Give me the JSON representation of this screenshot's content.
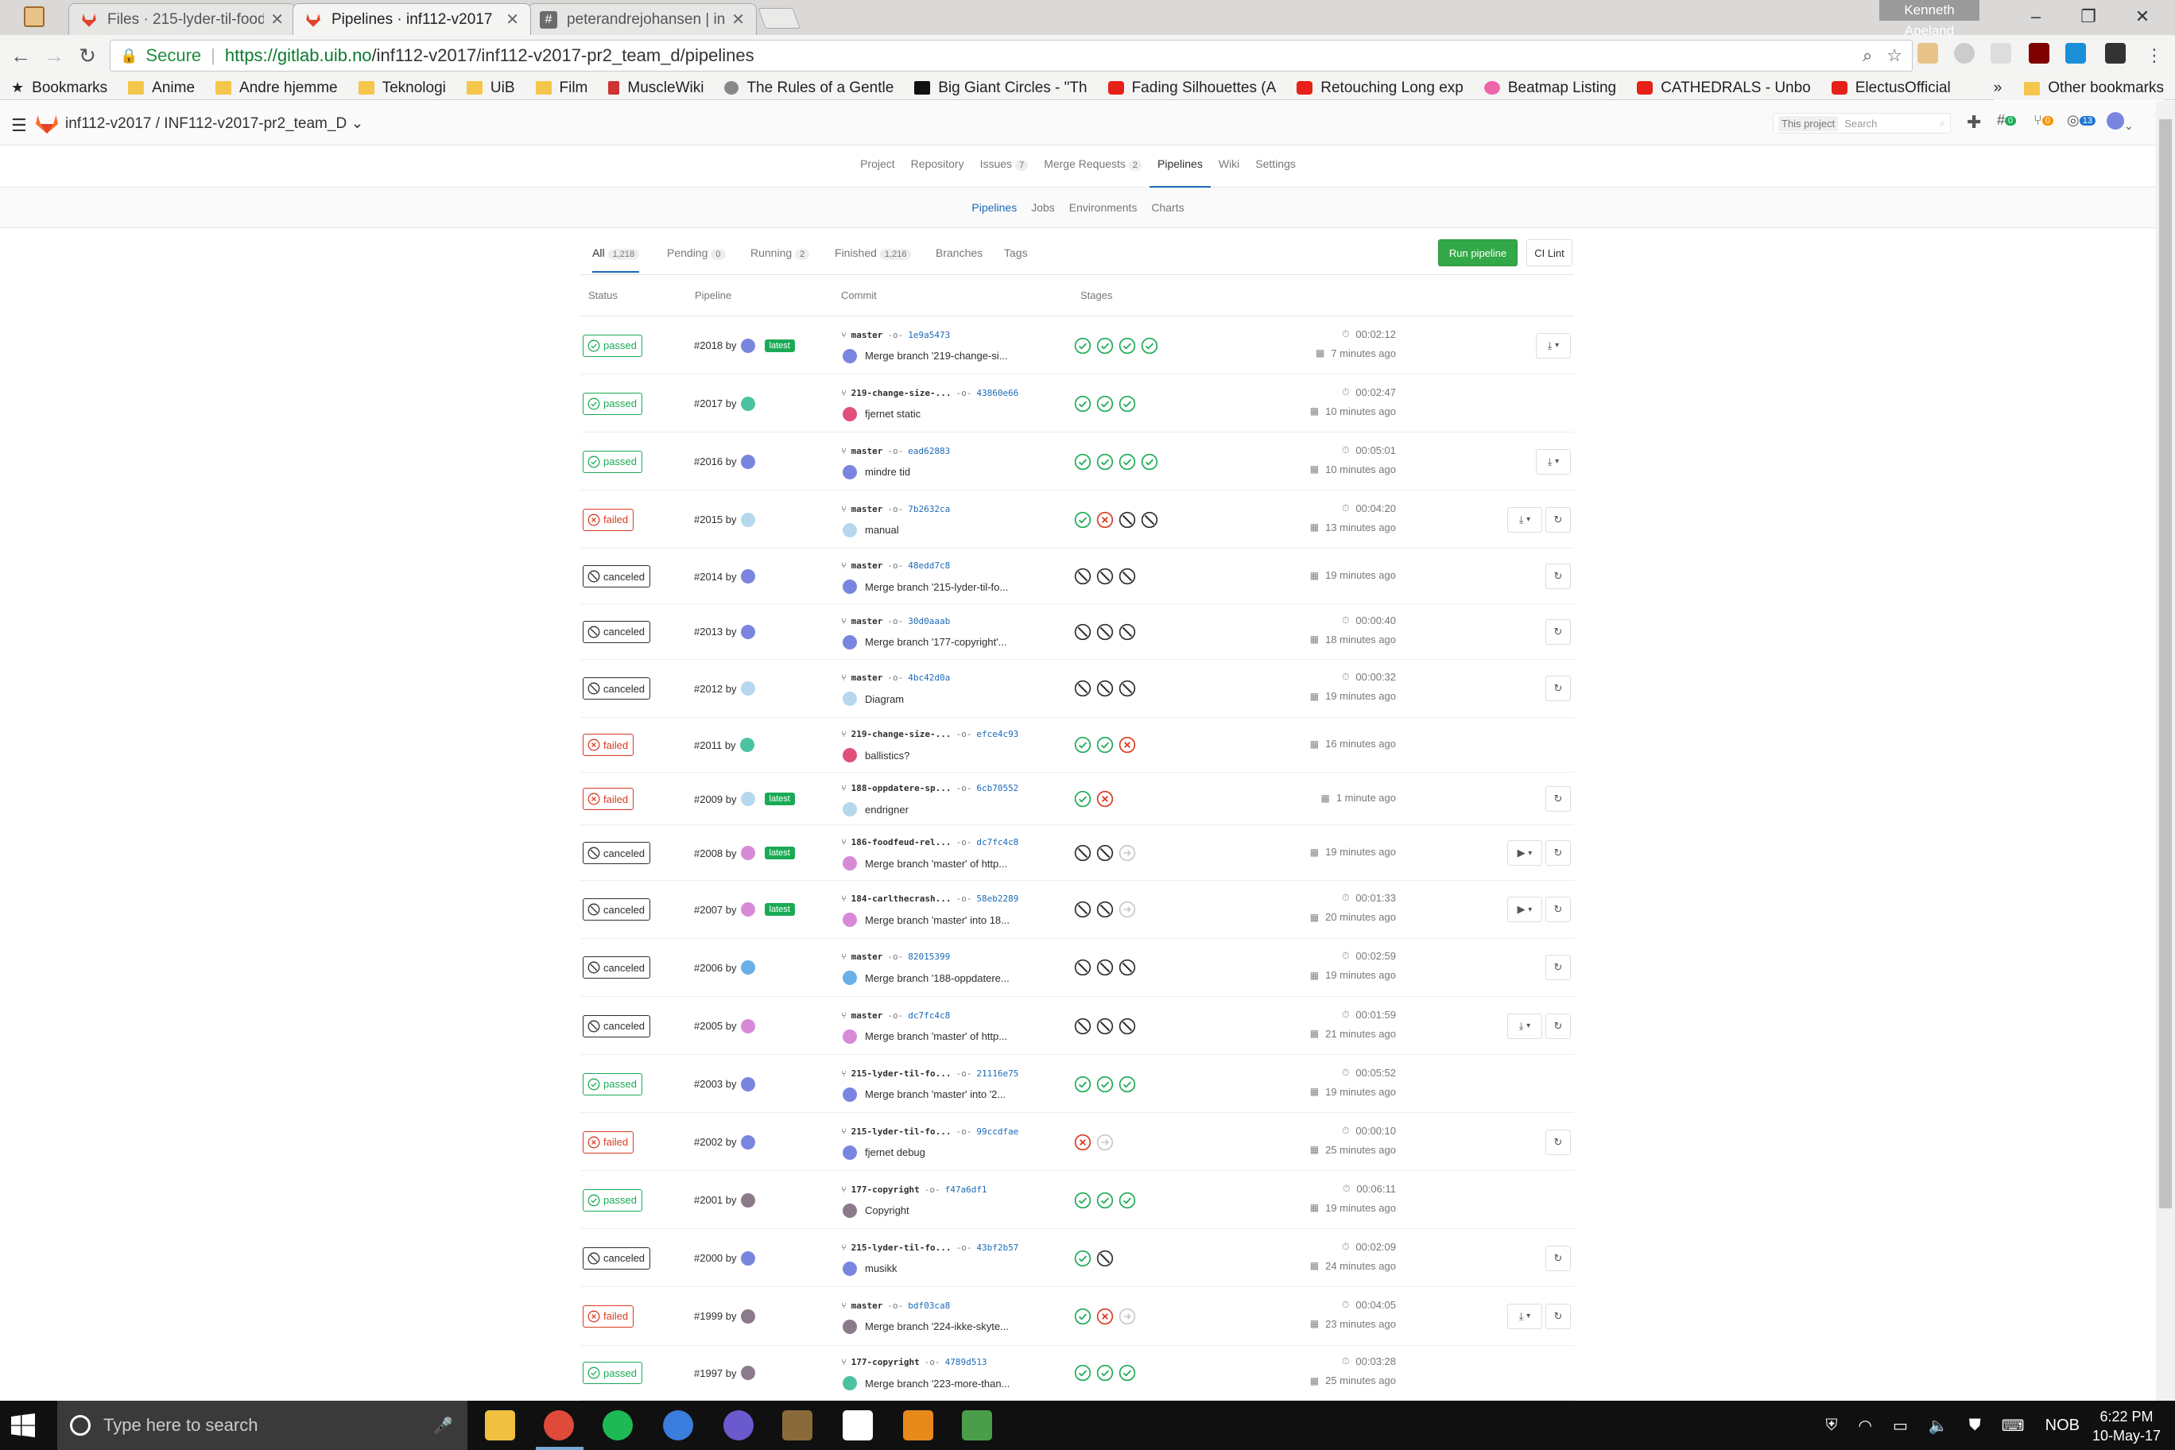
{
  "browser": {
    "tabs": [
      {
        "title": "Files · 215-lyder-til-foodf"
      },
      {
        "title": "Pipelines · inf112-v2017"
      },
      {
        "title": "peterandrejohansen | inf"
      }
    ],
    "profile_name": "Kenneth Apeland",
    "secure_label": "Secure",
    "url": "https://gitlab.uib.no/inf112-v2017/inf112-v2017-pr2_team_d/pipelines",
    "url_scheme_host": "https://gitlab.uib.no",
    "url_path": "/inf112-v2017/inf112-v2017-pr2_team_d/pipelines"
  },
  "bookmarks": {
    "items": [
      {
        "label": "Bookmarks",
        "icon": "star-icon"
      },
      {
        "label": "Anime",
        "icon": "folder-icon"
      },
      {
        "label": "Andre hjemme",
        "icon": "folder-icon"
      },
      {
        "label": "Teknologi",
        "icon": "folder-icon"
      },
      {
        "label": "UiB",
        "icon": "folder-icon"
      },
      {
        "label": "Film",
        "icon": "folder-icon"
      },
      {
        "label": "MuscleWiki",
        "icon": "site-icon"
      },
      {
        "label": "The Rules of a Gentle",
        "icon": "site-icon"
      },
      {
        "label": "Big Giant Circles - \"Th",
        "icon": "site-icon"
      },
      {
        "label": "Fading Silhouettes (A",
        "icon": "youtube-icon"
      },
      {
        "label": "Retouching Long exp",
        "icon": "youtube-icon"
      },
      {
        "label": "Beatmap Listing",
        "icon": "osu-icon"
      },
      {
        "label": "CATHEDRALS - Unbo",
        "icon": "youtube-icon"
      },
      {
        "label": "ElectusOfficial",
        "icon": "youtube-icon"
      }
    ],
    "overflow": "»",
    "other": "Other bookmarks"
  },
  "gitlab": {
    "breadcrumb": "inf112-v2017 / INF112-v2017-pr2_team_D",
    "search_scope": "This project",
    "search_placeholder": "Search",
    "header_counts": {
      "todos": "0",
      "merge_requests": "0",
      "issues": "13"
    },
    "project_tabs": [
      {
        "label": "Project"
      },
      {
        "label": "Repository"
      },
      {
        "label": "Issues",
        "count": "7"
      },
      {
        "label": "Merge Requests",
        "count": "2"
      },
      {
        "label": "Pipelines"
      },
      {
        "label": "Wiki"
      },
      {
        "label": "Settings"
      }
    ],
    "sub_tabs": [
      "Pipelines",
      "Jobs",
      "Environments",
      "Charts"
    ],
    "scope_tabs": [
      {
        "label": "All",
        "count": "1,218"
      },
      {
        "label": "Pending",
        "count": "0"
      },
      {
        "label": "Running",
        "count": "2"
      },
      {
        "label": "Finished",
        "count": "1,216"
      },
      {
        "label": "Branches"
      },
      {
        "label": "Tags"
      }
    ],
    "run_pipeline": "Run pipeline",
    "ci_lint": "CI Lint",
    "columns": {
      "status": "Status",
      "pipeline": "Pipeline",
      "commit": "Commit",
      "stages": "Stages"
    }
  },
  "pipelines": [
    {
      "status": "passed",
      "id": "#2018",
      "by": "by",
      "avatar": "#7a85e0",
      "latest": "latest",
      "ref": "master",
      "sha": "1e9a5473",
      "author_avatar": "#7a85e0",
      "message": "Merge branch '219-change-si...",
      "stages": [
        "s",
        "s",
        "s",
        "s"
      ],
      "duration": "00:02:12",
      "finished": "7 minutes ago",
      "actions": [
        "dl"
      ]
    },
    {
      "status": "passed",
      "id": "#2017",
      "by": "by",
      "avatar": "#4cc3a0",
      "latest": "",
      "ref": "219-change-size-...",
      "sha": "43860e66",
      "author_avatar": "#e0507a",
      "message": "fjernet static",
      "stages": [
        "s",
        "s",
        "s"
      ],
      "duration": "00:02:47",
      "finished": "10 minutes ago",
      "actions": []
    },
    {
      "status": "passed",
      "id": "#2016",
      "by": "by",
      "avatar": "#7a85e0",
      "latest": "",
      "ref": "master",
      "sha": "ead62883",
      "author_avatar": "#7a85e0",
      "message": "mindre tid",
      "stages": [
        "s",
        "s",
        "s",
        "s"
      ],
      "duration": "00:05:01",
      "finished": "10 minutes ago",
      "actions": [
        "dl"
      ]
    },
    {
      "status": "failed",
      "id": "#2015",
      "by": "by",
      "avatar": "#b6d8ee",
      "latest": "",
      "ref": "master",
      "sha": "7b2632ca",
      "author_avatar": "#b6d8ee",
      "message": "manual",
      "stages": [
        "s",
        "f",
        "c",
        "c"
      ],
      "duration": "00:04:20",
      "finished": "13 minutes ago",
      "actions": [
        "dl",
        "retry"
      ]
    },
    {
      "status": "canceled",
      "id": "#2014",
      "by": "by",
      "avatar": "#7a85e0",
      "latest": "",
      "ref": "master",
      "sha": "48edd7c8",
      "author_avatar": "#7a85e0",
      "message": "Merge branch '215-lyder-til-fo...",
      "stages": [
        "c",
        "c",
        "c"
      ],
      "duration": "",
      "finished": "19 minutes ago",
      "actions": [
        "retry"
      ]
    },
    {
      "status": "canceled",
      "id": "#2013",
      "by": "by",
      "avatar": "#7a85e0",
      "latest": "",
      "ref": "master",
      "sha": "30d0aaab",
      "author_avatar": "#7a85e0",
      "message": "Merge branch '177-copyright'...",
      "stages": [
        "c",
        "c",
        "c"
      ],
      "duration": "00:00:40",
      "finished": "18 minutes ago",
      "actions": [
        "retry"
      ]
    },
    {
      "status": "canceled",
      "id": "#2012",
      "by": "by",
      "avatar": "#b6d8ee",
      "latest": "",
      "ref": "master",
      "sha": "4bc42d0a",
      "author_avatar": "#b6d8ee",
      "message": "Diagram",
      "stages": [
        "c",
        "c",
        "c"
      ],
      "duration": "00:00:32",
      "finished": "19 minutes ago",
      "actions": [
        "retry"
      ]
    },
    {
      "status": "failed",
      "id": "#2011",
      "by": "by",
      "avatar": "#4cc3a0",
      "latest": "",
      "ref": "219-change-size-...",
      "sha": "efce4c93",
      "author_avatar": "#e0507a",
      "message": "ballistics?",
      "stages": [
        "s",
        "s",
        "f"
      ],
      "duration": "",
      "finished": "16 minutes ago",
      "actions": []
    },
    {
      "status": "failed",
      "id": "#2009",
      "by": "by",
      "avatar": "#b6d8ee",
      "latest": "latest",
      "ref": "188-oppdatere-sp...",
      "sha": "6cb70552",
      "author_avatar": "#b6d8ee",
      "message": "endrigner",
      "stages": [
        "s",
        "f"
      ],
      "duration": "",
      "finished": "1 minute ago",
      "actions": [
        "retry"
      ]
    },
    {
      "status": "canceled",
      "id": "#2008",
      "by": "by",
      "avatar": "#d88ad8",
      "latest": "latest",
      "ref": "186-foodfeud-rel...",
      "sha": "dc7fc4c8",
      "author_avatar": "#d88ad8",
      "message": "Merge branch 'master' of http...",
      "stages": [
        "c",
        "c",
        "k"
      ],
      "duration": "",
      "finished": "19 minutes ago",
      "actions": [
        "play",
        "retry"
      ]
    },
    {
      "status": "canceled",
      "id": "#2007",
      "by": "by",
      "avatar": "#d88ad8",
      "latest": "latest",
      "ref": "184-carlthecrash...",
      "sha": "58eb2289",
      "author_avatar": "#d88ad8",
      "message": "Merge branch 'master' into 18...",
      "stages": [
        "c",
        "c",
        "k"
      ],
      "duration": "00:01:33",
      "finished": "20 minutes ago",
      "actions": [
        "play",
        "retry"
      ]
    },
    {
      "status": "canceled",
      "id": "#2006",
      "by": "by",
      "avatar": "#6ab0e6",
      "latest": "",
      "ref": "master",
      "sha": "82015399",
      "author_avatar": "#6ab0e6",
      "message": "Merge branch '188-oppdatere...",
      "stages": [
        "c",
        "c",
        "c"
      ],
      "duration": "00:02:59",
      "finished": "19 minutes ago",
      "actions": [
        "retry"
      ]
    },
    {
      "status": "canceled",
      "id": "#2005",
      "by": "by",
      "avatar": "#d88ad8",
      "latest": "",
      "ref": "master",
      "sha": "dc7fc4c8",
      "author_avatar": "#d88ad8",
      "message": "Merge branch 'master' of http...",
      "stages": [
        "c",
        "c",
        "c"
      ],
      "duration": "00:01:59",
      "finished": "21 minutes ago",
      "actions": [
        "dl",
        "retry"
      ]
    },
    {
      "status": "passed",
      "id": "#2003",
      "by": "by",
      "avatar": "#7a85e0",
      "latest": "",
      "ref": "215-lyder-til-fo...",
      "sha": "21116e75",
      "author_avatar": "#7a85e0",
      "message": "Merge branch 'master' into '2...",
      "stages": [
        "s",
        "s",
        "s"
      ],
      "duration": "00:05:52",
      "finished": "19 minutes ago",
      "actions": []
    },
    {
      "status": "failed",
      "id": "#2002",
      "by": "by",
      "avatar": "#7a85e0",
      "latest": "",
      "ref": "215-lyder-til-fo...",
      "sha": "99ccdfae",
      "author_avatar": "#7a85e0",
      "message": "fjernet debug",
      "stages": [
        "f",
        "k"
      ],
      "duration": "00:00:10",
      "finished": "25 minutes ago",
      "actions": [
        "retry"
      ]
    },
    {
      "status": "passed",
      "id": "#2001",
      "by": "by",
      "avatar": "#8a7a8a",
      "latest": "",
      "ref": "177-copyright",
      "sha": "f47a6df1",
      "author_avatar": "#8a7a8a",
      "message": "Copyright",
      "stages": [
        "s",
        "s",
        "s"
      ],
      "duration": "00:06:11",
      "finished": "19 minutes ago",
      "actions": []
    },
    {
      "status": "canceled",
      "id": "#2000",
      "by": "by",
      "avatar": "#7a85e0",
      "latest": "",
      "ref": "215-lyder-til-fo...",
      "sha": "43bf2b57",
      "author_avatar": "#7a85e0",
      "message": "musikk",
      "stages": [
        "s",
        "c"
      ],
      "duration": "00:02:09",
      "finished": "24 minutes ago",
      "actions": [
        "retry"
      ]
    },
    {
      "status": "failed",
      "id": "#1999",
      "by": "by",
      "avatar": "#8a7a8a",
      "latest": "",
      "ref": "master",
      "sha": "bdf03ca8",
      "author_avatar": "#8a7a8a",
      "message": "Merge branch '224-ikke-skyte...",
      "stages": [
        "s",
        "f",
        "k"
      ],
      "duration": "00:04:05",
      "finished": "23 minutes ago",
      "actions": [
        "dl",
        "retry"
      ]
    },
    {
      "status": "passed",
      "id": "#1997",
      "by": "by",
      "avatar": "#8a7a8a",
      "latest": "",
      "ref": "177-copyright",
      "sha": "4789d513",
      "author_avatar": "#4cc3a0",
      "message": "Merge branch '223-more-than...",
      "stages": [
        "s",
        "s",
        "s"
      ],
      "duration": "00:03:28",
      "finished": "25 minutes ago",
      "actions": []
    }
  ],
  "taskbar": {
    "search_placeholder": "Type here to search",
    "language": "NOB",
    "time": "6:22 PM",
    "date": "10-May-17"
  }
}
